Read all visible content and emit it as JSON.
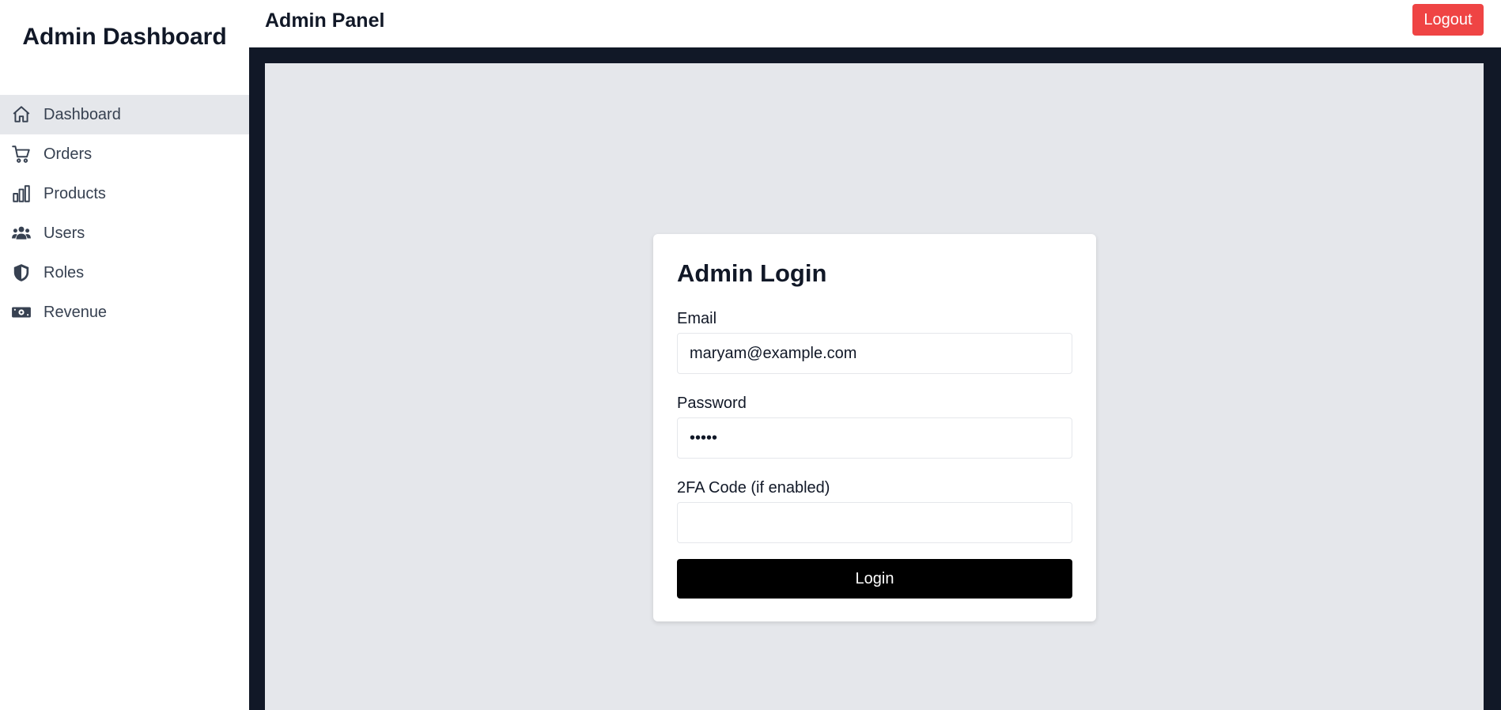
{
  "sidebar": {
    "title": "Admin Dashboard",
    "items": [
      {
        "label": "Dashboard",
        "icon": "home-icon",
        "active": true
      },
      {
        "label": "Orders",
        "icon": "cart-icon"
      },
      {
        "label": "Products",
        "icon": "bar-chart-icon"
      },
      {
        "label": "Users",
        "icon": "users-icon"
      },
      {
        "label": "Roles",
        "icon": "shield-icon"
      },
      {
        "label": "Revenue",
        "icon": "money-icon"
      }
    ]
  },
  "topbar": {
    "title": "Admin Panel",
    "logout_label": "Logout"
  },
  "login": {
    "title": "Admin Login",
    "email_label": "Email",
    "email_value": "maryam@example.com",
    "password_label": "Password",
    "password_value": "•••••",
    "twofa_label": "2FA Code (if enabled)",
    "twofa_value": "",
    "submit_label": "Login"
  },
  "colors": {
    "logout_bg": "#ef4444",
    "frame_bg": "#111827",
    "content_bg": "#e5e7eb",
    "active_nav_bg": "#e5e7eb",
    "login_button_bg": "#000000"
  }
}
